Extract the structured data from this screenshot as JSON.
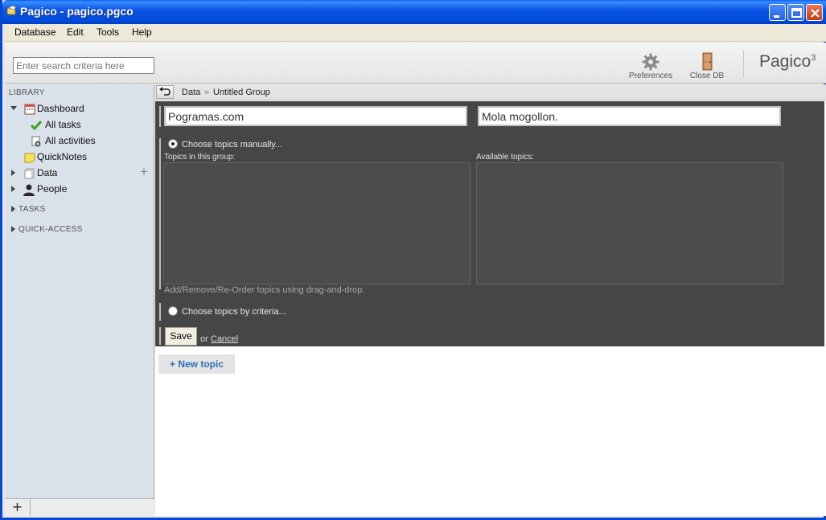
{
  "window": {
    "title": "Pagico - pagico.pgco"
  },
  "menu": {
    "items": [
      "Database",
      "Edit",
      "Tools",
      "Help"
    ]
  },
  "toolbar": {
    "search_placeholder": "Enter search criteria here",
    "preferences_label": "Preferences",
    "close_db_label": "Close DB",
    "brand_name": "Pagico",
    "brand_version": "3"
  },
  "sidebar": {
    "library_heading": "LIBRARY",
    "dashboard": "Dashboard",
    "all_tasks": "All tasks",
    "all_activities": "All activities",
    "quicknotes": "QuickNotes",
    "data": "Data",
    "people": "People",
    "tasks_heading": "TASKS",
    "quick_access_heading": "QUICK-ACCESS",
    "add_symbol": "+",
    "footer_add": "+"
  },
  "breadcrumb": {
    "root": "Data",
    "separator": "»",
    "current": "Untitled Group"
  },
  "group_editor": {
    "name_value": "Pogramas.com",
    "description_value": "Mola mogollon.",
    "manual_option_label": "Choose topics manually...",
    "topics_in_group_label": "Topics in this group:",
    "available_topics_label": "Available topics:",
    "hint": "Add/Remove/Re-Order topics using drag-and-drop.",
    "criteria_option_label": "Choose topics by criteria...",
    "save_label": "Save",
    "or_text": "or",
    "cancel_label": "Cancel"
  },
  "new_topic_label": "+ New topic",
  "colors": {
    "titlebar": "#0149d8",
    "panel": "#464646",
    "sidebar": "#d9e1ea",
    "link": "#2d6fb5"
  }
}
